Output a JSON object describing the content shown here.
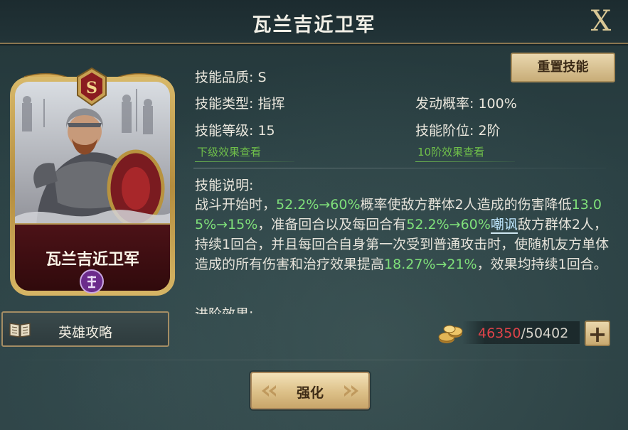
{
  "header": {
    "title": "瓦兰吉近卫军",
    "close_label": "X"
  },
  "card": {
    "rank": "S",
    "name": "瓦兰吉近卫军"
  },
  "guide": {
    "label": "英雄攻略"
  },
  "reset_button": {
    "label": "重置技能"
  },
  "skill": {
    "quality": "技能品质: S",
    "type": "技能类型: 指挥",
    "level": "技能等级: 15",
    "trigger_rate": "发动概率: 100%",
    "tier": "技能阶位: 2阶",
    "lower_effect_link": "下级效果查看",
    "tier10_effect_link": "10阶效果查看"
  },
  "description": {
    "title": "技能说明:",
    "segments": [
      {
        "text": "战斗开始时，",
        "style": "normal"
      },
      {
        "text": "52.2%→60%",
        "style": "hl"
      },
      {
        "text": "概率使敌方群体2人造成的伤害降低",
        "style": "normal"
      },
      {
        "text": "13.05%→15%",
        "style": "hl"
      },
      {
        "text": "，准备回合以及每回合有",
        "style": "normal"
      },
      {
        "text": "52.2%→60%",
        "style": "hl"
      },
      {
        "text": "嘲讽",
        "style": "kw"
      },
      {
        "text": "敌方群体2人，持续1回合，并且每回合自身第一次受到普通攻击时，使随机友方单体造成的所有伤害和治疗效果提高",
        "style": "normal"
      },
      {
        "text": "18.27%→21%",
        "style": "hl"
      },
      {
        "text": "，效果均持续1回合。",
        "style": "normal"
      }
    ],
    "next_section_title": "进阶效果:"
  },
  "resource": {
    "current": "46350",
    "separator": "/",
    "max": "50402",
    "icon": "gold-coins-icon"
  },
  "plus_button": {
    "label": "+"
  },
  "strengthen_button": {
    "label": "强化"
  },
  "colors": {
    "highlight": "#7fe07a",
    "link": "#6fbf4a",
    "insufficient": "#e0434a",
    "gold_frame": "#c8a563"
  }
}
